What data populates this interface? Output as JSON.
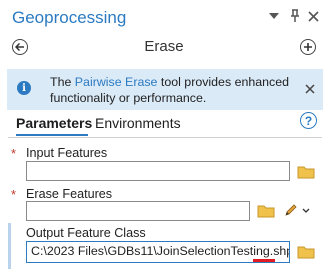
{
  "pane": {
    "title": "Geoprocessing",
    "tool_name": "Erase"
  },
  "title_icons": [
    "dropdown-icon",
    "pin-icon",
    "close-icon"
  ],
  "banner": {
    "prefix": "The ",
    "link": "Pairwise Erase",
    "suffix": " tool provides enhanced functionality or performance."
  },
  "tabs": [
    "Parameters",
    "Environments"
  ],
  "parameters": {
    "input_features": {
      "label": "Input Features",
      "required": "*",
      "value": ""
    },
    "erase_features": {
      "label": "Erase Features",
      "required": "*",
      "value": ""
    },
    "output_feature_class": {
      "label": "Output Feature Class",
      "value": "C:\\2023 Files\\GDBs11\\JoinSelectionTesting.shp"
    }
  },
  "colors": {
    "accent": "#2c7bc2",
    "banner_bg": "#dbeaf7",
    "required": "#c0392b",
    "annotation": "#e11b22"
  }
}
